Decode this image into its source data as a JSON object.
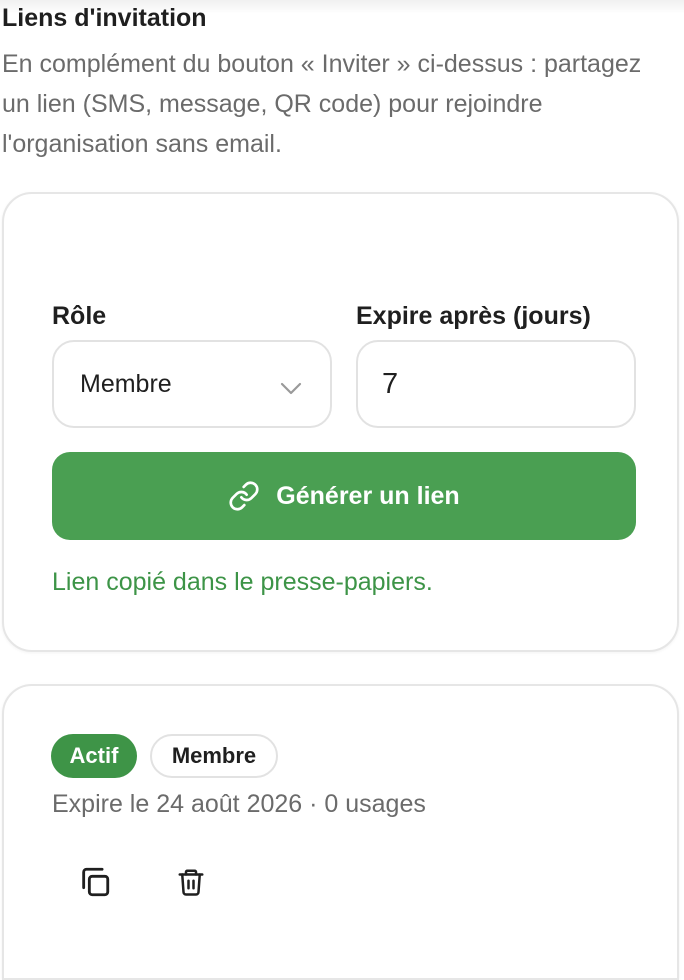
{
  "section": {
    "title": "Liens d'invitation",
    "description": "En complément du bouton « Inviter » ci-dessus : partagez un lien (SMS, message, QR code) pour rejoindre l'organisation sans email."
  },
  "form": {
    "role_label": "Rôle",
    "role_value": "Membre",
    "expire_label": "Expire après (jours)",
    "expire_value": "7",
    "generate_button_label": "Générer un lien",
    "copied_message": "Lien copié dans le presse-papiers."
  },
  "invite_link": {
    "status_badge": "Actif",
    "role_badge": "Membre",
    "meta": "Expire le 24 août 2026 · 0 usages",
    "actions": [
      {
        "name": "copy",
        "icon": "copy-icon"
      },
      {
        "name": "delete",
        "icon": "trash-icon"
      }
    ]
  },
  "colors": {
    "primary_green": "#4a9f52",
    "badge_green": "#3e9447",
    "success_text": "#3d9447",
    "muted_text": "#6b6b6b"
  }
}
